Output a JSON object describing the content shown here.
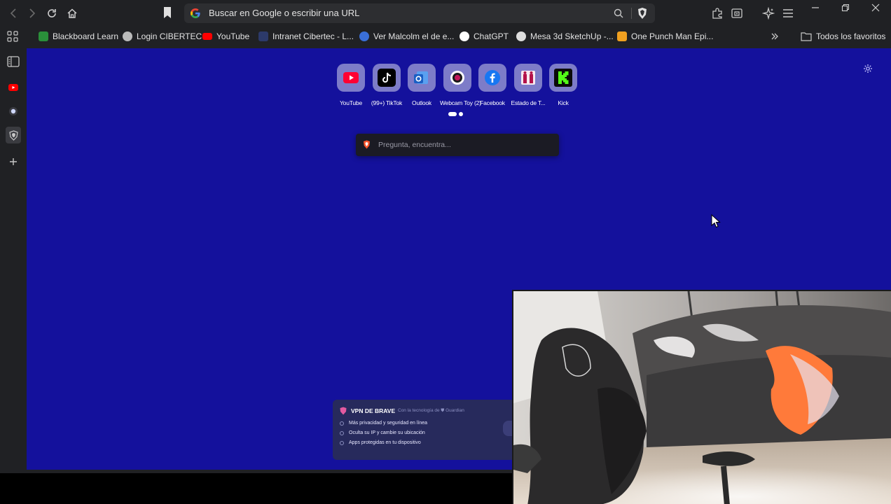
{
  "urlbar": {
    "placeholder": "Buscar en Google o escribir una URL"
  },
  "bookmarks": [
    {
      "label": "Blackboard Learn",
      "icon": "blackboard-icon",
      "color": "#2a8f3a"
    },
    {
      "label": "Login CIBERTEC",
      "icon": "globe-icon",
      "color": "#bbbbbb"
    },
    {
      "label": "YouTube",
      "icon": "youtube-icon",
      "color": "#ff0000"
    },
    {
      "label": "Intranet Cibertec - L...",
      "icon": "intranet-icon",
      "color": "#2c3a6a"
    },
    {
      "label": "Ver Malcolm el de e...",
      "icon": "malcolm-icon",
      "color": "#3a6fd8"
    },
    {
      "label": "ChatGPT",
      "icon": "chatgpt-icon",
      "color": "#ffffff"
    },
    {
      "label": "Mesa 3d SketchUp -...",
      "icon": "sketchup-icon",
      "color": "#dddddd"
    },
    {
      "label": "One Punch Man Epi...",
      "icon": "animeflv-icon",
      "color": "#f0a020"
    }
  ],
  "all_bookmarks_label": "Todos los favoritos",
  "tiles": [
    {
      "label": "YouTube",
      "icon": "youtube-icon",
      "color": "#ff0033"
    },
    {
      "label": "(99+) TikTok",
      "icon": "tiktok-icon",
      "color": "#000000"
    },
    {
      "label": "Outlook",
      "icon": "outlook-icon",
      "color": "#2a6fd6"
    },
    {
      "label": "Webcam Toy (2)",
      "icon": "webcam-toy-icon",
      "color": "#c2185b"
    },
    {
      "label": "Facebook",
      "icon": "facebook-icon",
      "color": "#1877f2"
    },
    {
      "label": "Estado de T...",
      "icon": "estado-icon",
      "color": "#b3124a"
    },
    {
      "label": "Kick",
      "icon": "kick-icon",
      "color": "#53fc18"
    }
  ],
  "search": {
    "placeholder": "Pregunta, encuentra..."
  },
  "vpn": {
    "title": "VPN DE BRAVE",
    "powered_by": "Con la tecnología de ⛊ Guardian",
    "features": [
      "Más privacidad y seguridad en línea",
      "Oculta su IP y cambie su ubicación",
      "Apps protegidas en tu dispositivo"
    ]
  },
  "colors": {
    "ntp_background": "#14119c",
    "chrome_background": "#202124"
  }
}
